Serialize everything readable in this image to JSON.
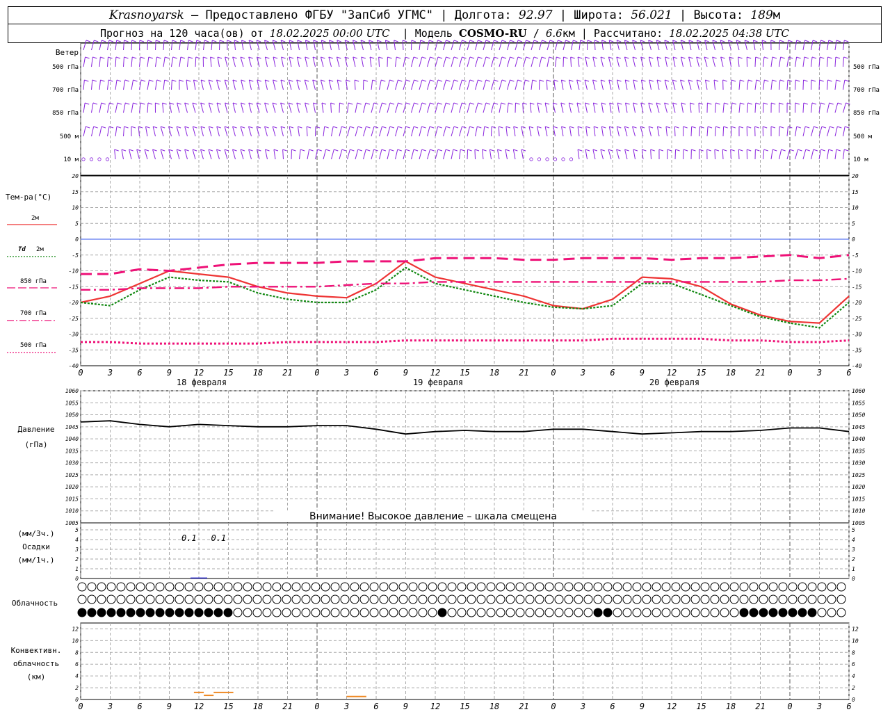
{
  "header": {
    "city": "Krasnoyarsk",
    "dash": "–",
    "provider": "Предоставлено ФГБУ \"ЗапСиб УГМС\"",
    "lon_label": "Долгота:",
    "lon": "92.97",
    "lat_label": "Широта:",
    "lat": "56.021",
    "alt_label": "Высота:",
    "alt": "189",
    "alt_unit": "м",
    "forecast_label": "Прогноз на 120 часа(ов) от",
    "forecast_from": "18.02.2025 00:00 UTC",
    "model_label": "Модель",
    "model": "COSMO-RU",
    "model_res": "6.6",
    "model_res_unit": "км",
    "calc_label": "Рассчитано:",
    "calc_time": "18.02.2025 04:38 UTC",
    "sep": "|"
  },
  "labels": {
    "wind": "Ветер",
    "levels": [
      "500 гПа",
      "700 гПа",
      "850 гПа",
      "500 м",
      "10 м"
    ],
    "temp": "Тем-ра(°С)",
    "t2m": "2м",
    "td_sym": "Td",
    "td2m": "2м",
    "t850": "850 гПа",
    "t700": "700 гПа",
    "t500": "500 гПа",
    "pressure1": "Давление",
    "pressure2": "(гПа)",
    "warning": "Внимание! Высокое давление – шкала смещена",
    "precip1": "(мм/3ч.)",
    "precip2": "Осадки",
    "precip3": "(мм/1ч.)",
    "cloud": "Облачность",
    "conv1": "Конвективн.",
    "conv2": "облачность",
    "conv3": "(км)"
  },
  "colors": {
    "t2m": "#ee3333",
    "td": "#118811",
    "t850": "#ee1177",
    "t700": "#ee1177",
    "t500": "#ee1177",
    "wind": "#8822dd",
    "pressure": "#000000",
    "precip": "#2222cc",
    "conv": "#ee8822",
    "zero": "#3355ee"
  },
  "chart_data": [
    {
      "type": "line",
      "title": "Тем-ра(°С)",
      "ylim": [
        -40,
        20
      ],
      "x_hours": [
        0,
        3,
        6,
        9,
        12,
        15,
        18,
        21,
        24,
        27,
        30,
        33,
        36,
        39,
        42,
        45,
        48,
        51,
        54,
        57,
        60,
        63,
        66,
        69,
        72,
        75,
        78
      ],
      "x_tick_labels": [
        "0",
        "3",
        "6",
        "9",
        "12",
        "15",
        "18",
        "21",
        "0",
        "3",
        "6",
        "9",
        "12",
        "15",
        "18",
        "21",
        "0",
        "3",
        "6",
        "9",
        "12",
        "15",
        "18",
        "21",
        "0",
        "3",
        "6"
      ],
      "date_labels": [
        "18 февраля",
        "19 февраля",
        "20 февраля"
      ],
      "series": [
        {
          "name": "2м",
          "values": [
            -20,
            -18,
            -14,
            -10,
            -11,
            -12,
            -15,
            -17,
            -18,
            -18.5,
            -14,
            -7,
            -12,
            -14,
            -16,
            -18,
            -21,
            -22,
            -19,
            -12,
            -12.5,
            -15,
            -20.5,
            -24,
            -26,
            -26.5,
            -18
          ]
        },
        {
          "name": "Td 2м",
          "values": [
            -20,
            -21,
            -16,
            -12,
            -13,
            -13.5,
            -17,
            -19,
            -20,
            -20,
            -16,
            -9,
            -14,
            -16,
            -18,
            -20,
            -21.5,
            -22,
            -21,
            -14,
            -14,
            -17.5,
            -21,
            -24.5,
            -26.5,
            -28,
            -20
          ]
        },
        {
          "name": "850 гПа",
          "values": [
            -11,
            -11,
            -9.5,
            -10,
            -9,
            -8,
            -7.5,
            -7.5,
            -7.5,
            -7,
            -7,
            -7,
            -6,
            -6,
            -6,
            -6.5,
            -6.5,
            -6,
            -6,
            -6,
            -6.5,
            -6,
            -6,
            -5.5,
            -5,
            -6,
            -5
          ]
        },
        {
          "name": "700 гПа",
          "values": [
            -16,
            -16,
            -15.5,
            -15.5,
            -15.5,
            -15,
            -15,
            -15,
            -15,
            -14.5,
            -14,
            -14,
            -13.5,
            -13.5,
            -13.5,
            -13.5,
            -13.5,
            -13.5,
            -13.5,
            -13.5,
            -13.5,
            -13.5,
            -13.5,
            -13.5,
            -13,
            -13,
            -12.5
          ]
        },
        {
          "name": "500 гПа",
          "values": [
            -32.5,
            -32.5,
            -33,
            -33,
            -33,
            -33,
            -33,
            -32.5,
            -32.5,
            -32.5,
            -32.5,
            -32,
            -32,
            -32,
            -32,
            -32,
            -32,
            -32,
            -31.5,
            -31.5,
            -31.5,
            -31.5,
            -32,
            -32,
            -32.5,
            -32.5,
            -32
          ]
        }
      ]
    },
    {
      "type": "line",
      "title": "Давление",
      "ylabel": "(гПа)",
      "ylim": [
        1005,
        1060
      ],
      "y_ticks": [
        1005,
        1010,
        1015,
        1020,
        1025,
        1030,
        1035,
        1040,
        1045,
        1050,
        1055,
        1060
      ],
      "x_hours": [
        0,
        3,
        6,
        9,
        12,
        15,
        18,
        21,
        24,
        27,
        30,
        33,
        36,
        39,
        42,
        45,
        48,
        51,
        54,
        57,
        60,
        63,
        66,
        69,
        72,
        75,
        78
      ],
      "series": [
        {
          "name": "Давление",
          "values": [
            1047,
            1047.5,
            1046,
            1045,
            1046,
            1045.5,
            1045,
            1045,
            1045.5,
            1045.5,
            1044,
            1042,
            1043,
            1043.5,
            1043,
            1043,
            1044,
            1044,
            1043,
            1042,
            1042.5,
            1043,
            1043,
            1043.5,
            1044.5,
            1044.5,
            1043
          ]
        }
      ]
    },
    {
      "type": "bar",
      "title": "Осадки",
      "ylim": [
        0,
        5
      ],
      "annotations": [
        {
          "hour": 11,
          "text": "0.1"
        },
        {
          "hour": 14,
          "text": "0.1"
        }
      ],
      "bars": [
        {
          "hour": 12,
          "value": 0.1
        }
      ]
    },
    {
      "type": "bar",
      "title": "Конвективн. облачность",
      "ylim": [
        0,
        13
      ],
      "y_ticks": [
        0,
        2,
        4,
        6,
        8,
        10,
        12
      ],
      "segments": [
        {
          "from": 11.5,
          "to": 12.5,
          "value": 1.2
        },
        {
          "from": 12.5,
          "to": 13.5,
          "value": 0.7
        },
        {
          "from": 13.5,
          "to": 15.5,
          "value": 1.2
        },
        {
          "from": 27,
          "to": 29,
          "value": 0.5
        }
      ]
    }
  ]
}
